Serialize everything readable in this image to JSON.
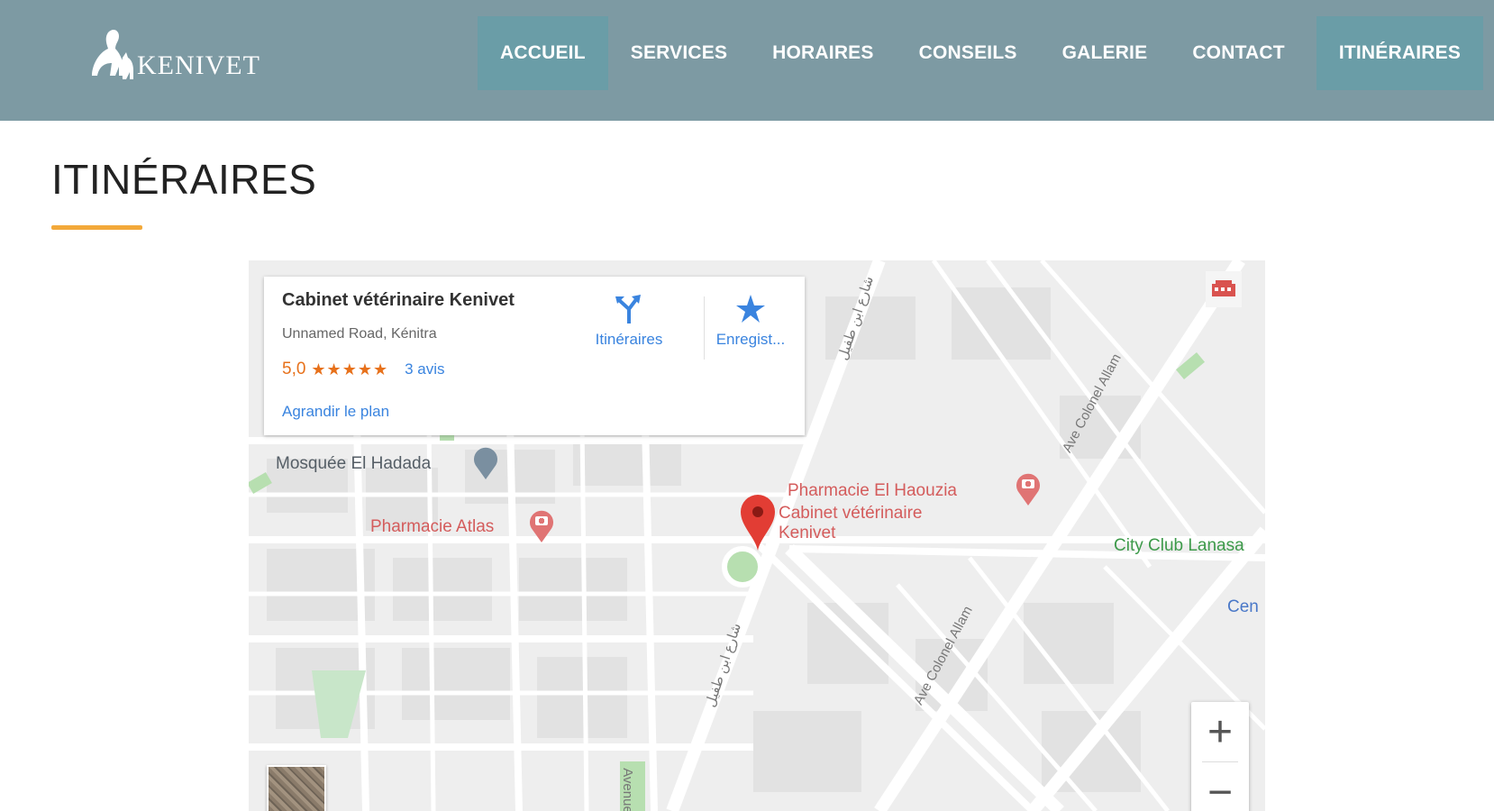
{
  "header": {
    "logo_text": "KENIVET",
    "nav": [
      {
        "label": "ACCUEIL"
      },
      {
        "label": "SERVICES"
      },
      {
        "label": "HORAIRES"
      },
      {
        "label": "CONSEILS"
      },
      {
        "label": "GALERIE"
      },
      {
        "label": "CONTACT"
      },
      {
        "label": "ITINÉRAIRES"
      }
    ]
  },
  "page": {
    "title": "ITINÉRAIRES"
  },
  "map": {
    "card": {
      "name": "Cabinet vétérinaire Kenivet",
      "address": "Unnamed Road, Kénitra",
      "rating": "5,0",
      "stars": "★★★★★",
      "reviews": "3 avis",
      "enlarge": "Agrandir le plan",
      "directions_label": "Itinéraires",
      "save_label": "Enregist..."
    },
    "labels": {
      "mosque": "Mosquée El Hadada",
      "pharmacie_atlas": "Pharmacie Atlas",
      "pharmacie_haouzia": "Pharmacie El Haouzia",
      "cabinet_line1": "Cabinet vétérinaire",
      "cabinet_line2": "Kenivet",
      "city_club": "City Club Lanasa",
      "cen": "Cen",
      "ave_colonel_1": "Ave Colonel Allam",
      "ave_colonel_2": "Ave Colonel Allam",
      "street_arabic_1": "شارع ابن طفيل",
      "street_arabic_2": "شارع ابن طفيل",
      "street_vertical": "Avenue"
    },
    "zoom_in": "+",
    "zoom_out": "−"
  },
  "icons": {
    "directions": "directions-icon",
    "save": "star-icon",
    "pin": "map-pin-icon",
    "mosque": "mosque-icon",
    "pharmacy": "pharmacy-icon",
    "fullscreen": "fullscreen-icon"
  },
  "colors": {
    "header_bg": "#7d9aa3",
    "nav_active": "#6a9da7",
    "accent": "#f3a93a",
    "link": "#3a84df",
    "rating": "#e7711b"
  }
}
